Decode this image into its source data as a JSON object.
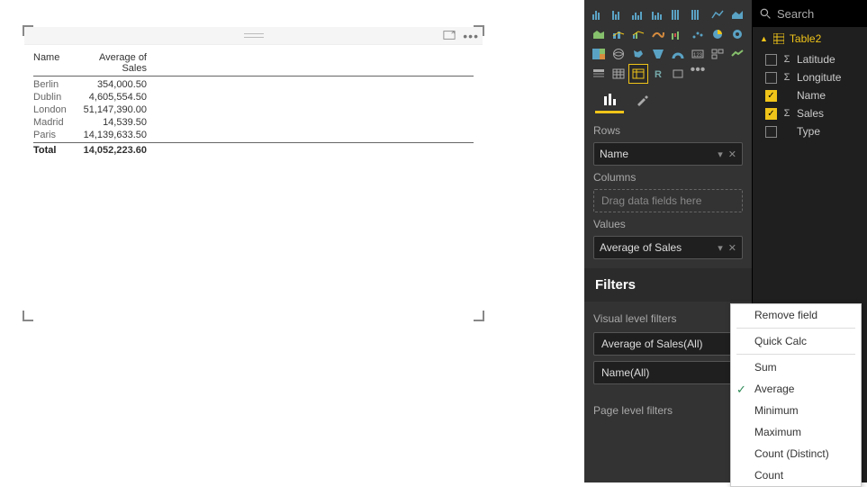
{
  "table_header": {
    "name": "Name",
    "value": "Average of Sales"
  },
  "rows": [
    {
      "name": "Berlin",
      "value": "354,000.50"
    },
    {
      "name": "Dublin",
      "value": "4,605,554.50"
    },
    {
      "name": "London",
      "value": "51,147,390.00"
    },
    {
      "name": "Madrid",
      "value": "14,539.50"
    },
    {
      "name": "Paris",
      "value": "14,139,633.50"
    }
  ],
  "total": {
    "label": "Total",
    "value": "14,052,223.60"
  },
  "wells": {
    "rows_label": "Rows",
    "rows_field": "Name",
    "columns_label": "Columns",
    "columns_placeholder": "Drag data fields here",
    "values_label": "Values",
    "values_field": "Average of Sales"
  },
  "filters": {
    "header": "Filters",
    "visual_label": "Visual level filters",
    "visual_items": [
      "Average of Sales(All)",
      "Name(All)"
    ],
    "page_label": "Page level filters"
  },
  "fields_panel": {
    "search_placeholder": "Search",
    "table_name": "Table2",
    "fields": [
      {
        "name": "Latitude",
        "checked": false,
        "sigma": true
      },
      {
        "name": "Longitute",
        "checked": false,
        "sigma": true
      },
      {
        "name": "Name",
        "checked": true,
        "sigma": false
      },
      {
        "name": "Sales",
        "checked": true,
        "sigma": true
      },
      {
        "name": "Type",
        "checked": false,
        "sigma": false
      }
    ]
  },
  "context_menu": {
    "remove": "Remove field",
    "quick_calc": "Quick Calc",
    "sum": "Sum",
    "average": "Average",
    "minimum": "Minimum",
    "maximum": "Maximum",
    "count_distinct": "Count (Distinct)",
    "count": "Count",
    "selected": "average"
  },
  "chart_data": {
    "type": "table",
    "columns": [
      "Name",
      "Average of Sales"
    ],
    "rows": [
      [
        "Berlin",
        354000.5
      ],
      [
        "Dublin",
        4605554.5
      ],
      [
        "London",
        51147390.0
      ],
      [
        "Madrid",
        14539.5
      ],
      [
        "Paris",
        14139633.5
      ]
    ],
    "totals": [
      "Total",
      14052223.6
    ]
  }
}
